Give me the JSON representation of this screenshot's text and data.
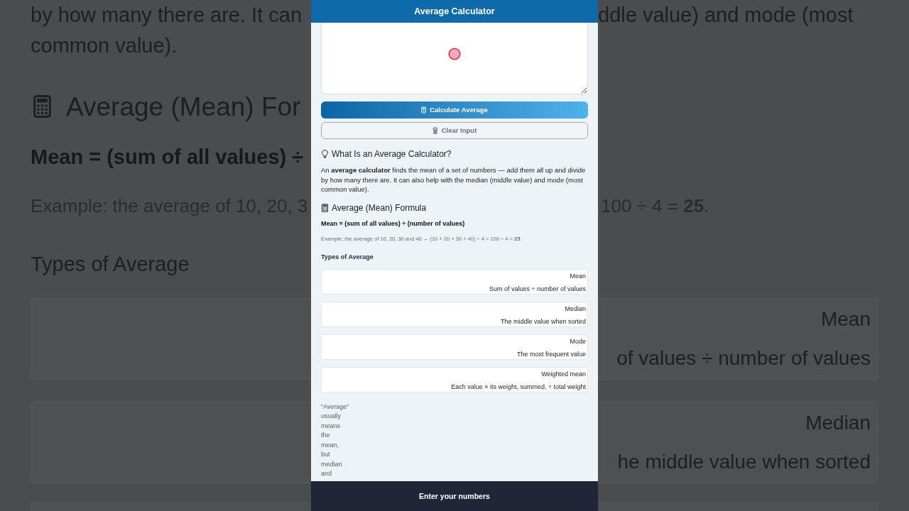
{
  "backdrop": {
    "left": {
      "paragraph_lines": [
        "by how many there are. It can",
        "common value)."
      ],
      "formula_heading": "Average (Mean) For",
      "formula": "Mean = (sum of all values) ÷",
      "example": "Example: the average of 10, 20, 3",
      "types_heading": "Types of Average"
    },
    "right": {
      "paragraph_line": "ddle value) and mode (most",
      "example": "100 ÷ 4 = **25**.",
      "types": [
        {
          "name": "Mean",
          "description": "of values ÷ number of values"
        },
        {
          "name": "Median",
          "description": "he middle value when sorted"
        }
      ]
    }
  },
  "app_bar": {
    "title": "Average Calculator"
  },
  "buttons": [
    {
      "kind": "primary",
      "label": "Calculate Average"
    },
    {
      "kind": "secondary",
      "label": "Clear Input"
    }
  ],
  "about": {
    "heading": "What Is an Average Calculator?",
    "text": "An **average calculator** finds the mean of a set of numbers — add them all up and divide by how many there are. It can also help with the median (middle value) and mode (most common value)."
  },
  "formula": {
    "heading": "Average (Mean) Formula",
    "formula": "Mean = (sum of all values) ÷ (number of values)",
    "example": "Example: the average of 10, 20, 30 and 40 → (10 + 20 + 30 + 40) ÷ 4 = 100 ÷ 4 = **25**."
  },
  "types": {
    "heading": "Types of Average",
    "items": [
      {
        "name": "Mean",
        "description": "Sum of values ÷ number of values"
      },
      {
        "name": "Median",
        "description": "The middle value when sorted"
      },
      {
        "name": "Mode",
        "description": "The most frequent value"
      },
      {
        "name": "Weighted mean",
        "description": "Each value × its weight, summed, ÷ total weight"
      }
    ]
  },
  "note": "“Average” usually means the mean, but median and",
  "bottom_bar": {
    "label": "Enter your numbers"
  }
}
